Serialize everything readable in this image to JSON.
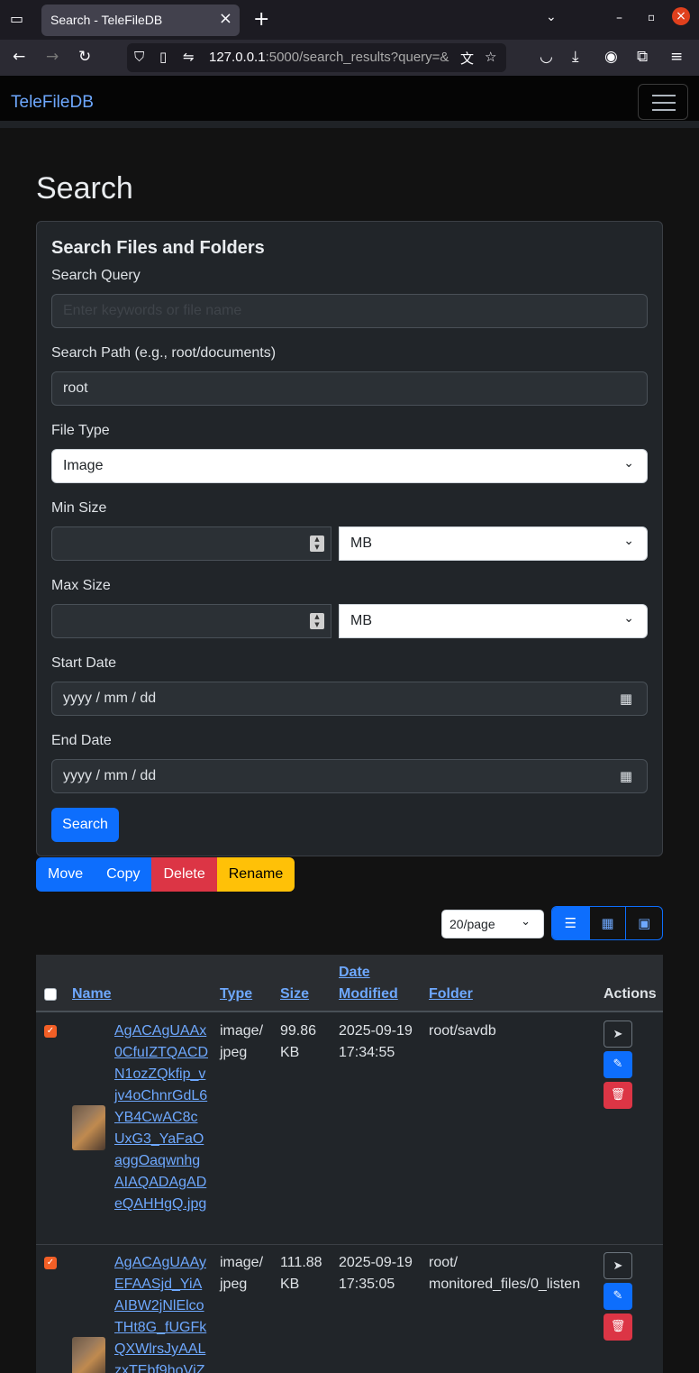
{
  "browser": {
    "tab_title": "Search - TeleFileDB",
    "url_host": "127.0.0.1",
    "url_rest": ":5000/search_results?query=&"
  },
  "app": {
    "brand": "TeleFileDB"
  },
  "page": {
    "title": "Search"
  },
  "form": {
    "card_title": "Search Files and Folders",
    "query_label": "Search Query",
    "query_placeholder": "Enter keywords or file name",
    "path_label": "Search Path (e.g., root/documents)",
    "path_value": "root",
    "type_label": "File Type",
    "type_value": "Image",
    "min_label": "Min Size",
    "min_unit": "MB",
    "max_label": "Max Size",
    "max_unit": "MB",
    "start_label": "Start Date",
    "start_value": "yyyy / mm / dd",
    "end_label": "End Date",
    "end_value": "yyyy / mm / dd",
    "search_button": "Search"
  },
  "actions": {
    "move": "Move",
    "copy": "Copy",
    "delete": "Delete",
    "rename": "Rename"
  },
  "controls": {
    "per_page": "20/page"
  },
  "table": {
    "headers": {
      "name": "Name",
      "type": "Type",
      "size": "Size",
      "date1": "Date",
      "date2": "Modified",
      "folder": "Folder",
      "actions": "Actions"
    },
    "rows": [
      {
        "name": "AgACAgUAAx0CfuIZTQACDN1ozZQkfip_vjv4oChnrGdL6YB4CwAC8cUxG3_YaFaOaggOaqwnhgAIAQADAgADeQAHHgQ.jpg",
        "type": "image/ jpeg",
        "size": "99.86 KB",
        "date": "2025-09-19 17:34:55",
        "folder": "root/savdb",
        "checked": true
      },
      {
        "name": "AgACAgUAAyEFAASjd_YiAAIBW2jNlElcoTHt8G_fUGFkQXWlrsJyAALzxTEbf9hoVjZ",
        "type": "image/ jpeg",
        "size": "111.88 KB",
        "date": "2025-09-19 17:35:05",
        "folder": "root/ monitored_files/0_listen",
        "checked": true
      }
    ]
  },
  "icons": [
    "tab-list-icon",
    "close-icon",
    "new-tab-icon",
    "chevron-down-icon",
    "minimize-icon",
    "restore-icon",
    "window-close-icon",
    "back-icon",
    "forward-icon",
    "reload-icon",
    "shield-icon",
    "page-icon",
    "permissions-icon",
    "translate-icon",
    "bookmark-star-icon",
    "pocket-icon",
    "download-icon",
    "account-icon",
    "extensions-icon",
    "menu-icon",
    "calendar-icon",
    "list-view-icon",
    "grid-view-icon",
    "gallery-view-icon",
    "send-icon",
    "pencil-icon",
    "trash-icon"
  ],
  "colors": {
    "primary": "#0d6efd",
    "danger": "#dc3545",
    "warning": "#ffc107",
    "link": "#6ea8fe",
    "check": "#f25f26"
  }
}
